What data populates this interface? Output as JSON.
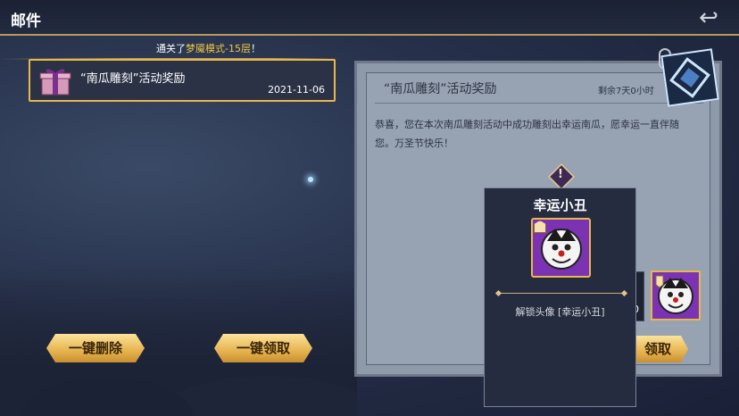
{
  "header": {
    "title": "邮件",
    "back_icon": "back-arrow-icon"
  },
  "marquee": {
    "prefix": "通关了",
    "highlight": "梦魇模式-15层",
    "suffix": "！"
  },
  "mail_list": [
    {
      "icon": "gift-box-icon",
      "title": "“南瓜雕刻”活动奖励",
      "date": "2021-11-06"
    }
  ],
  "actions": {
    "delete_all": "一键删除",
    "claim_all": "一键领取"
  },
  "detail": {
    "title": "“南瓜雕刻”活动奖励",
    "remaining": "剩余7天0小时",
    "body": "恭喜，您在本次南瓜雕刻活动中成功雕刻出幸运南瓜，愿幸运一直伴随您。万圣节快乐！",
    "claim_label": "领取",
    "reward_count": "0"
  },
  "tooltip": {
    "title": "幸运小丑",
    "description": "解锁头像 [幸运小丑]"
  },
  "colors": {
    "gold": "#e8b84a",
    "highlight": "#f0c640",
    "purple": "#7c33b3"
  }
}
